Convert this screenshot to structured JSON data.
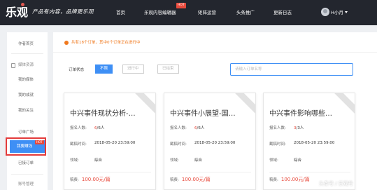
{
  "brand": {
    "logo_text": "乐观",
    "slogan": "产品有内容，品牌更乐观"
  },
  "nav": {
    "items": [
      "首页",
      "乐观内容编辑器",
      "矩阵运营",
      "头条推广",
      "更新日志"
    ],
    "hot_badge": "HOT",
    "username": "H小月"
  },
  "sidebar": {
    "items": [
      "作者首页",
      "媒体资源",
      "我的媒体",
      "我的成就",
      "我的关注",
      "订单广场",
      "我要赚钱",
      "已接订单",
      "账号管理"
    ],
    "active_badge": "HOT"
  },
  "main": {
    "notice": "共有18个订单，其中0个订单正在进行中",
    "filter_label": "订单状态",
    "filters": [
      "不限",
      "进行中",
      "已结束"
    ],
    "search_placeholder": "请输入订单名称"
  },
  "cards": [
    {
      "title": "中兴事件现状分析-…",
      "enroll_label": "报名人数:",
      "enrolled": "6",
      "total": "/6人",
      "deadline_label": "截稿时间:",
      "deadline": "2018-05-20 23:59:00",
      "field_label": "领域:",
      "field": "综合",
      "fee_label": "稿费:",
      "fee": "100.00元/篇"
    },
    {
      "title": "中兴事件小展望-国…",
      "enroll_label": "报名人数:",
      "enrolled": "6",
      "total": "/6人",
      "deadline_label": "截稿时间:",
      "deadline": "2018-05-20 23:59:00",
      "field_label": "领域:",
      "field": "综合",
      "fee_label": "稿费:",
      "fee": "100.00元/篇"
    },
    {
      "title": "中兴事件影响哪些…",
      "enroll_label": "报名人数:",
      "enrolled": "3",
      "total": "/3人",
      "deadline_label": "截稿时间:",
      "deadline": "2018-05-20 23:59:00",
      "field_label": "领域:",
      "field": "综合",
      "fee_label": "稿费:",
      "fee": "100.00元/篇"
    }
  ],
  "watermark": "头条号 / 乐观号",
  "colors": {
    "topbar": "#23262e",
    "accent": "#3e8ff5",
    "hot": "#e84a3c",
    "notice": "#f0791e",
    "highlight_frame": "#e33b3b"
  }
}
